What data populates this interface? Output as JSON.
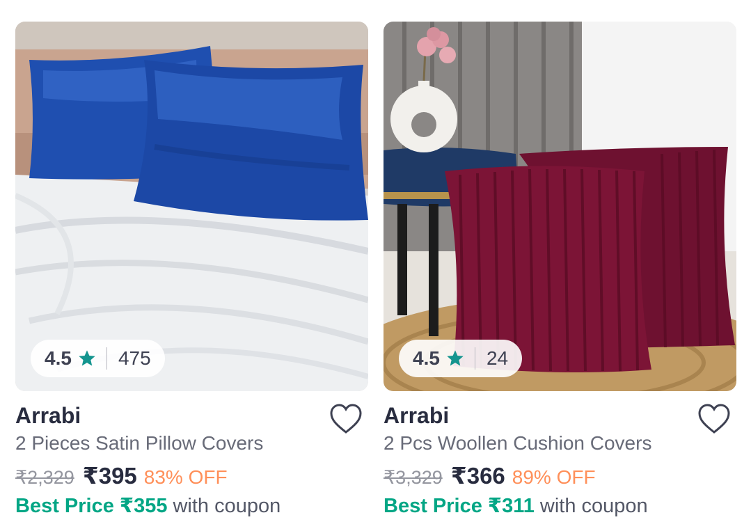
{
  "products": [
    {
      "image": "blue-satin-pillow-covers",
      "rating": "4.5",
      "rating_count": "475",
      "brand": "Arrabi",
      "title": "2 Pieces Satin Pillow Covers",
      "mrp": "₹2,329",
      "price": "₹395",
      "discount": "83% OFF",
      "best_price": "Best Price ₹355",
      "coupon_text": "with coupon"
    },
    {
      "image": "maroon-woollen-cushion-covers",
      "rating": "4.5",
      "rating_count": "24",
      "brand": "Arrabi",
      "title": "2 Pcs Woollen Cushion Covers",
      "mrp": "₹3,329",
      "price": "₹366",
      "discount": "89% OFF",
      "best_price": "Best Price ₹311",
      "coupon_text": "with coupon"
    }
  ],
  "colors": {
    "star": "#14958f",
    "discount": "#ff905a",
    "best_price": "#03a685",
    "text_dark": "#282c3f",
    "text_muted": "#686b78"
  },
  "icons": {
    "rating": "star-icon",
    "wishlist": "heart-outline-icon"
  }
}
